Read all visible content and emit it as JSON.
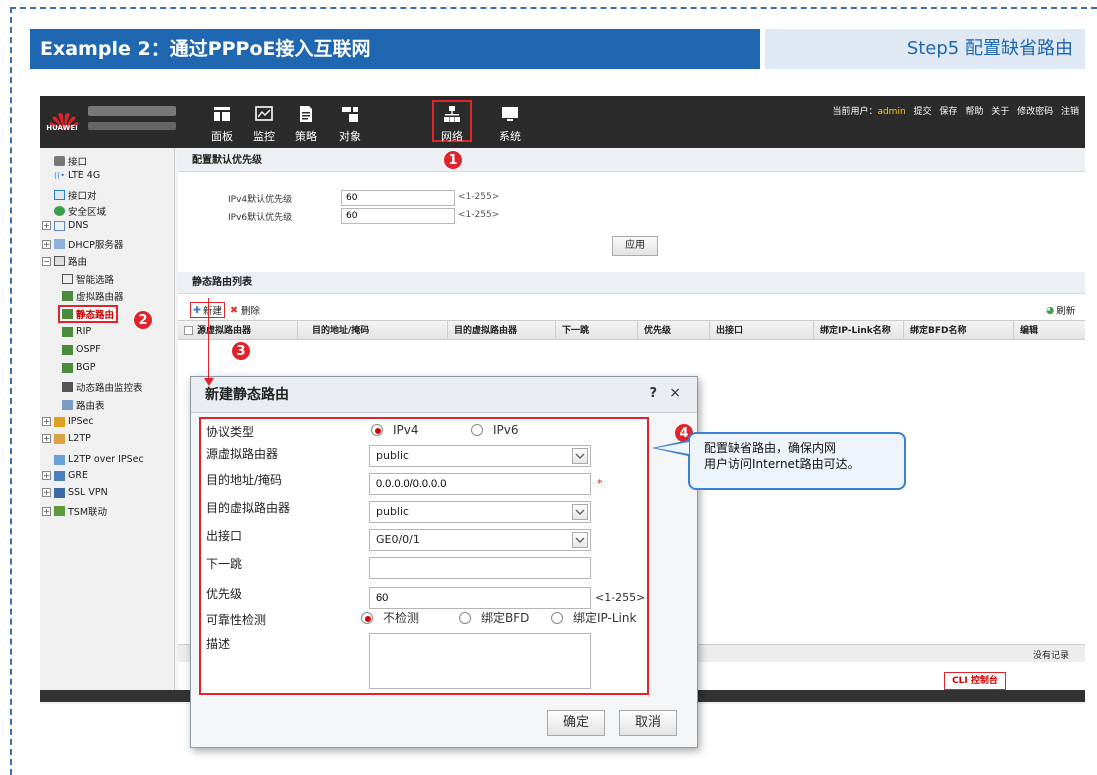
{
  "banner": {
    "title": "Example 2：通过PPPoE接入互联网",
    "step": "Step5 配置缺省路由"
  },
  "app": {
    "logo_text": "HUAWEI",
    "nav": [
      {
        "label": "面板",
        "icon": "dashboard-icon"
      },
      {
        "label": "监控",
        "icon": "monitor-icon"
      },
      {
        "label": "策略",
        "icon": "policy-icon"
      },
      {
        "label": "对象",
        "icon": "object-icon"
      },
      {
        "label": "网络",
        "icon": "network-icon",
        "selected": true
      },
      {
        "label": "系统",
        "icon": "system-icon"
      }
    ],
    "user": {
      "prefix": "当前用户：",
      "name": "admin",
      "links": [
        "提交",
        "保存",
        "帮助",
        "关于",
        "修改密码",
        "注销"
      ]
    }
  },
  "sidebar": {
    "items": [
      "接口",
      "LTE 4G",
      "接口对",
      "安全区域",
      "DNS",
      "DHCP服务器",
      "路由",
      "智能选路",
      "虚拟路由器",
      "静态路由",
      "RIP",
      "OSPF",
      "BGP",
      "动态路由监控表",
      "路由表",
      "IPSec",
      "L2TP",
      "L2TP over IPSec",
      "GRE",
      "SSL VPN",
      "TSM联动"
    ]
  },
  "priority": {
    "title": "配置默认优先级",
    "ipv4_label": "IPv4默认优先级",
    "ipv4_value": "60",
    "ipv4_hint": "<1-255>",
    "ipv6_label": "IPv6默认优先级",
    "ipv6_value": "60",
    "ipv6_hint": "<1-255>",
    "apply": "应用"
  },
  "route_list": {
    "title": "静态路由列表",
    "new": "新建",
    "delete": "删除",
    "refresh": "刷新",
    "columns": [
      "源虚拟路由器",
      "目的地址/掩码",
      "目的虚拟路由器",
      "下一跳",
      "优先级",
      "出接口",
      "绑定IP-Link名称",
      "绑定BFD名称",
      "编辑"
    ],
    "no_records": "没有记录",
    "cli": "CLI 控制台"
  },
  "dialog": {
    "title": "新建静态路由",
    "help": "?",
    "close": "×",
    "protocol_label": "协议类型",
    "protocol_opts": [
      "IPv4",
      "IPv6"
    ],
    "src_vr_label": "源虚拟路由器",
    "src_vr_value": "public",
    "dest_label": "目的地址/掩码",
    "dest_value": "0.0.0.0/0.0.0.0",
    "required": "*",
    "dest_vr_label": "目的虚拟路由器",
    "dest_vr_value": "public",
    "out_if_label": "出接口",
    "out_if_value": "GE0/0/1",
    "next_hop_label": "下一跳",
    "priority_label": "优先级",
    "priority_value": "60",
    "priority_hint": "<1-255>",
    "reliability_label": "可靠性检测",
    "reliability_opts": [
      "不检测",
      "绑定BFD",
      "绑定IP-Link"
    ],
    "desc_label": "描述",
    "ok": "确定",
    "cancel": "取消"
  },
  "annotations": {
    "badges": [
      "1",
      "2",
      "3",
      "4"
    ],
    "callout_line1": "配置缺省路由，确保内网",
    "callout_line2": "用户访问Internet路由可达。"
  },
  "colors": {
    "banner_blue": "#1f67b0",
    "highlight_red": "#e0242b",
    "callout_blue": "#3d7fd1"
  }
}
